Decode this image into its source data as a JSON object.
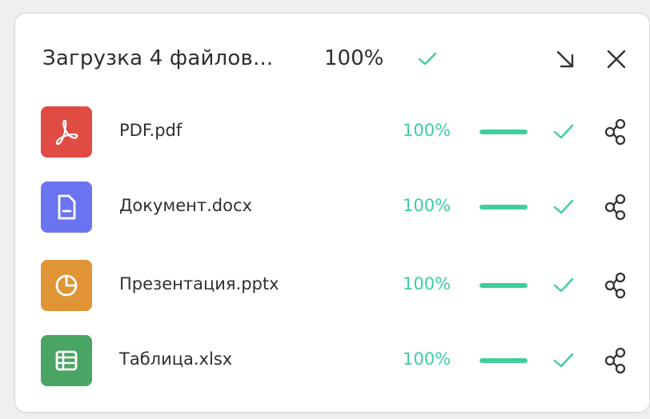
{
  "header": {
    "title": "Загрузка 4 файлов...",
    "overall_percent": "100%",
    "collapse_icon": "collapse-arrow-icon",
    "close_icon": "close-icon"
  },
  "colors": {
    "accent": "#3ecf9a",
    "pdf": "#e04b43",
    "docx": "#6b74f0",
    "pptx": "#e09435",
    "xlsx": "#4aa564"
  },
  "files": [
    {
      "name": "PDF.pdf",
      "percent": "100%",
      "progress": 1.0,
      "icon": "pdf-icon"
    },
    {
      "name": "Документ.docx",
      "percent": "100%",
      "progress": 1.0,
      "icon": "document-icon"
    },
    {
      "name": "Презентация.pptx",
      "percent": "100%",
      "progress": 1.0,
      "icon": "pie-chart-icon"
    },
    {
      "name": "Таблица.xlsx",
      "percent": "100%",
      "progress": 1.0,
      "icon": "table-icon"
    }
  ]
}
